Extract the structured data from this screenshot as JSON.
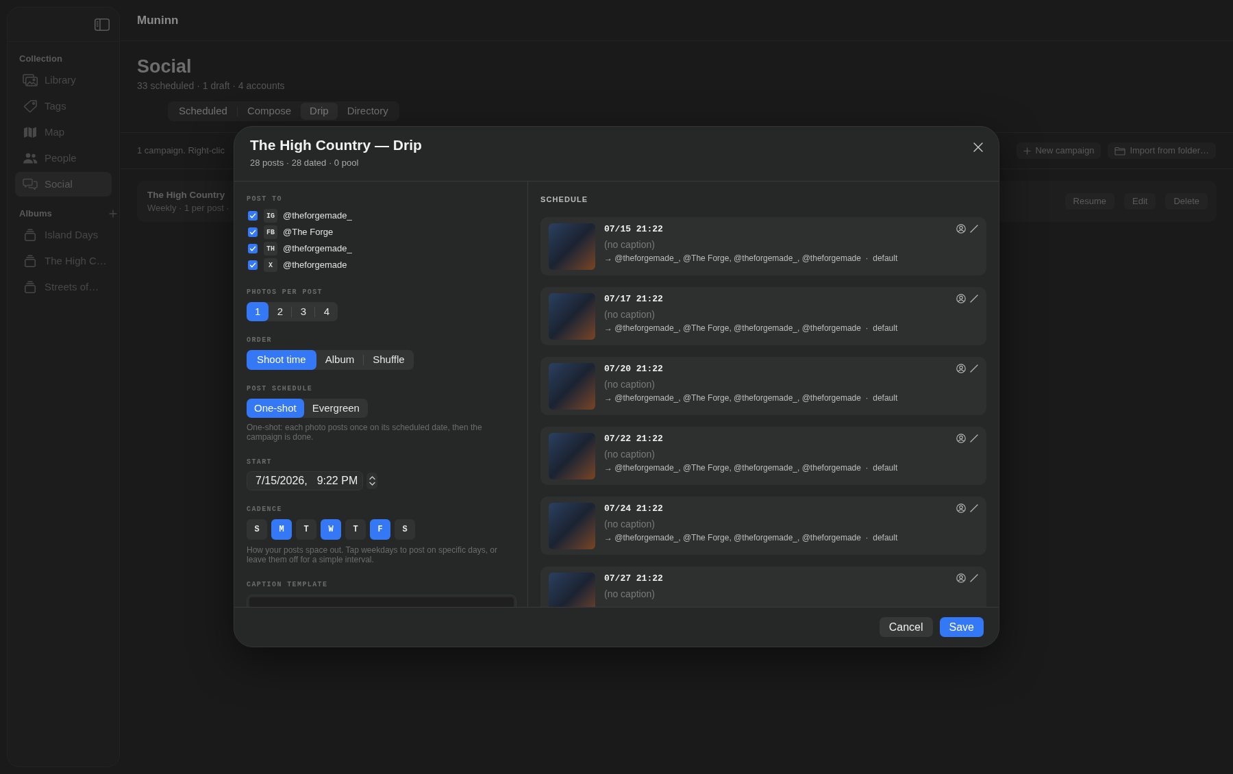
{
  "app_title": "Muninn",
  "sidebar": {
    "sections": [
      {
        "title": "Collection",
        "add_button": false,
        "items": [
          {
            "label": "Library",
            "selected": false
          },
          {
            "label": "Tags",
            "selected": false
          },
          {
            "label": "Map",
            "selected": false
          },
          {
            "label": "People",
            "selected": false
          },
          {
            "label": "Social",
            "selected": true
          }
        ]
      },
      {
        "title": "Albums",
        "add_button": true,
        "items": [
          {
            "label": "Island Days",
            "selected": false
          },
          {
            "label": "The High C…",
            "selected": false
          },
          {
            "label": "Streets of…",
            "selected": false
          }
        ]
      }
    ]
  },
  "page": {
    "title": "Social",
    "subtitle": "33 scheduled · 1 draft · 4 accounts",
    "tabs": [
      {
        "label": "Scheduled",
        "selected": false
      },
      {
        "label": "Compose",
        "selected": false
      },
      {
        "label": "Drip",
        "selected": true
      },
      {
        "label": "Directory",
        "selected": false
      }
    ]
  },
  "toolbar": {
    "info": "1 campaign. Right-clic",
    "buttons": [
      "New campaign",
      "Import from folder…"
    ]
  },
  "campaigns": [
    {
      "title": "The High Country",
      "meta": "Weekly · 1 per post ·",
      "actions": [
        "Resume",
        "Edit",
        "Delete"
      ]
    }
  ],
  "dialog": {
    "title": "The High Country — Drip",
    "subtitle": "28 posts · 28 dated · 0 pool",
    "post_to": {
      "label": "POST TO",
      "accounts": [
        {
          "network": "IG",
          "handle": "@theforgemade_",
          "checked": true
        },
        {
          "network": "FB",
          "handle": "@The Forge",
          "checked": true
        },
        {
          "network": "TH",
          "handle": "@theforgemade_",
          "checked": true
        },
        {
          "network": "X",
          "handle": "@theforgemade",
          "checked": true
        }
      ]
    },
    "photos_per_post": {
      "label": "PHOTOS PER POST",
      "options": [
        {
          "label": "1",
          "selected": true
        },
        {
          "label": "2",
          "selected": false
        },
        {
          "label": "3",
          "selected": false
        },
        {
          "label": "4",
          "selected": false
        }
      ]
    },
    "order": {
      "label": "ORDER",
      "options": [
        {
          "label": "Shoot time",
          "selected": true
        },
        {
          "label": "Album",
          "selected": false
        },
        {
          "label": "Shuffle",
          "selected": false
        }
      ]
    },
    "post_schedule": {
      "label": "POST SCHEDULE",
      "options": [
        {
          "label": "One-shot",
          "selected": true
        },
        {
          "label": "Evergreen",
          "selected": false
        }
      ],
      "help": "One-shot: each photo posts once on its scheduled date, then the campaign is done."
    },
    "start": {
      "label": "START",
      "date": "7/15/2026,",
      "time": "9:22 PM"
    },
    "cadence": {
      "label": "CADENCE",
      "days": [
        {
          "label": "S",
          "selected": false
        },
        {
          "label": "M",
          "selected": true
        },
        {
          "label": "T",
          "selected": false
        },
        {
          "label": "W",
          "selected": true
        },
        {
          "label": "T",
          "selected": false
        },
        {
          "label": "F",
          "selected": true
        },
        {
          "label": "S",
          "selected": false
        }
      ],
      "help": "How your posts space out. Tap weekdays to post on specific days, or leave them off for a simple interval."
    },
    "caption_template": {
      "label": "CAPTION TEMPLATE"
    },
    "schedule": {
      "label": "SCHEDULE",
      "posts": [
        {
          "date": "07/15 21:22",
          "caption": "(no caption)",
          "targets": "→ @theforgemade_, @The Forge, @theforgemade_, @theforgemade  ·  default"
        },
        {
          "date": "07/17 21:22",
          "caption": "(no caption)",
          "targets": "→ @theforgemade_, @The Forge, @theforgemade_, @theforgemade  ·  default"
        },
        {
          "date": "07/20 21:22",
          "caption": "(no caption)",
          "targets": "→ @theforgemade_, @The Forge, @theforgemade_, @theforgemade  ·  default"
        },
        {
          "date": "07/22 21:22",
          "caption": "(no caption)",
          "targets": "→ @theforgemade_, @The Forge, @theforgemade_, @theforgemade  ·  default"
        },
        {
          "date": "07/24 21:22",
          "caption": "(no caption)",
          "targets": "→ @theforgemade_, @The Forge, @theforgemade_, @theforgemade  ·  default"
        },
        {
          "date": "07/27 21:22",
          "caption": "(no caption)"
        }
      ]
    },
    "buttons": [
      {
        "label": "Cancel",
        "primary": false
      },
      {
        "label": "Save",
        "primary": true
      }
    ]
  }
}
